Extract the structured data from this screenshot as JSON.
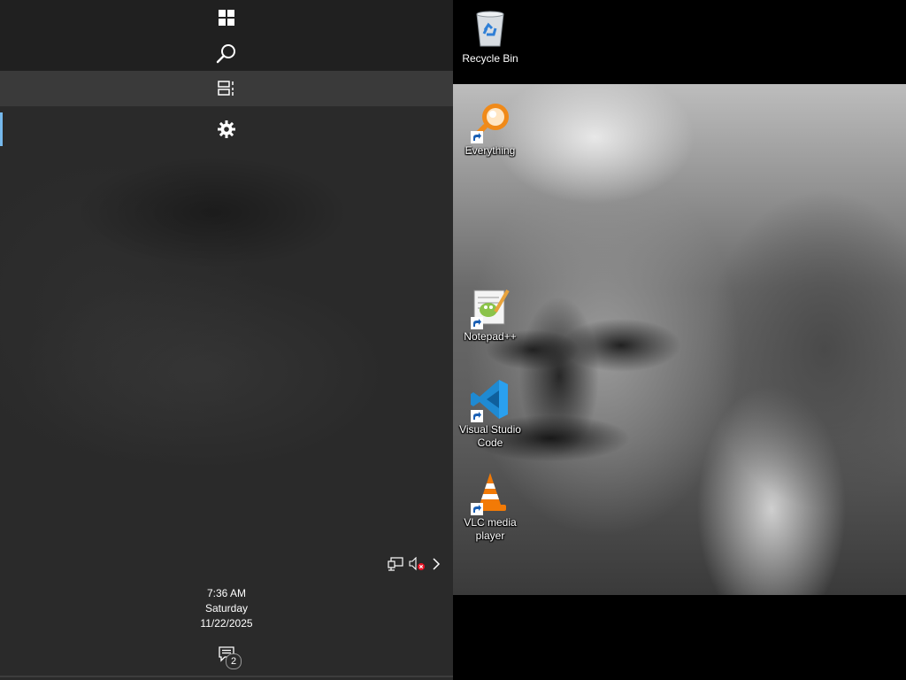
{
  "taskbar": {
    "buttons": [
      {
        "name": "start",
        "icon": "windows-logo-icon"
      },
      {
        "name": "search",
        "icon": "search-icon"
      },
      {
        "name": "task-view",
        "icon": "task-view-icon"
      },
      {
        "name": "settings",
        "icon": "gear-icon"
      }
    ],
    "tray": {
      "network_icon": "network-icon",
      "volume_icon": "volume-muted-icon",
      "chevron_icon": "chevron-right-icon"
    },
    "clock": {
      "time": "7:36 AM",
      "day": "Saturday",
      "date": "11/22/2025"
    },
    "notifications": {
      "icon": "action-center-icon",
      "count": "2"
    },
    "active_indicator_color": "#76b9ed"
  },
  "desktop": {
    "icons": [
      {
        "label": "Recycle Bin",
        "icon": "recycle-bin-icon"
      },
      {
        "label": "Everything",
        "icon": "everything-search-icon"
      },
      {
        "label": "Notepad++",
        "icon": "notepad-plus-plus-icon"
      },
      {
        "label": "Visual Studio Code",
        "icon": "vscode-icon"
      },
      {
        "label": "VLC media player",
        "icon": "vlc-cone-icon"
      }
    ]
  }
}
